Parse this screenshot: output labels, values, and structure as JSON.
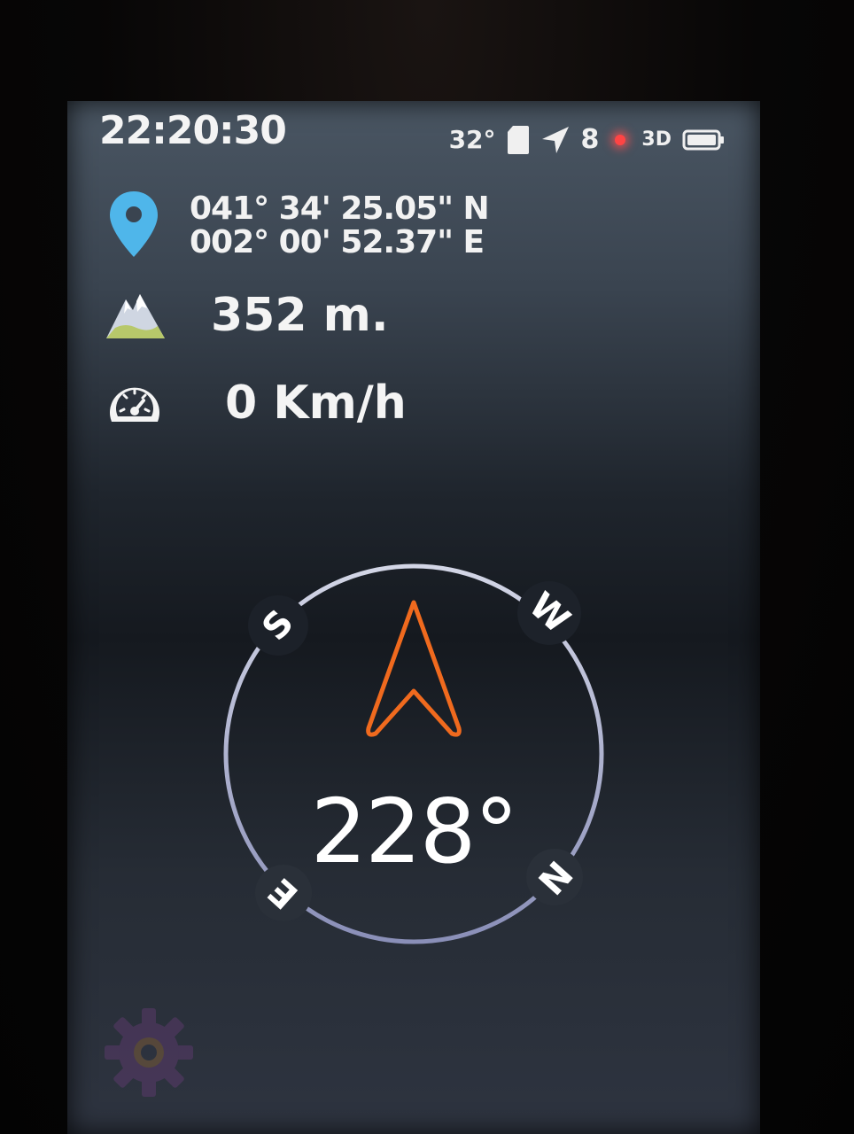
{
  "status_bar": {
    "time": "22:20:30",
    "temperature": "32°",
    "satellites": "8",
    "fix_mode": "3D",
    "icons": [
      "sd-card-icon",
      "navigation-arrow-icon",
      "recording-dot-icon",
      "battery-icon"
    ]
  },
  "location": {
    "latitude": "041° 34' 25.05\" N",
    "longitude": "002° 00' 52.37\" E",
    "icon": "map-pin-icon"
  },
  "altitude": {
    "value": "352 m.",
    "icon": "mountain-icon"
  },
  "speed": {
    "value": "0 Km/h",
    "icon": "speedometer-icon"
  },
  "compass": {
    "heading": "228°",
    "labels": {
      "n": "N",
      "e": "E",
      "s": "S",
      "w": "W"
    },
    "arrow_color": "#f06a1e",
    "ring_color": "#c9ccdd"
  },
  "settings": {
    "icon": "gear-icon"
  },
  "colors": {
    "pin": "#4fb6ea",
    "accent": "#f06a1e"
  }
}
